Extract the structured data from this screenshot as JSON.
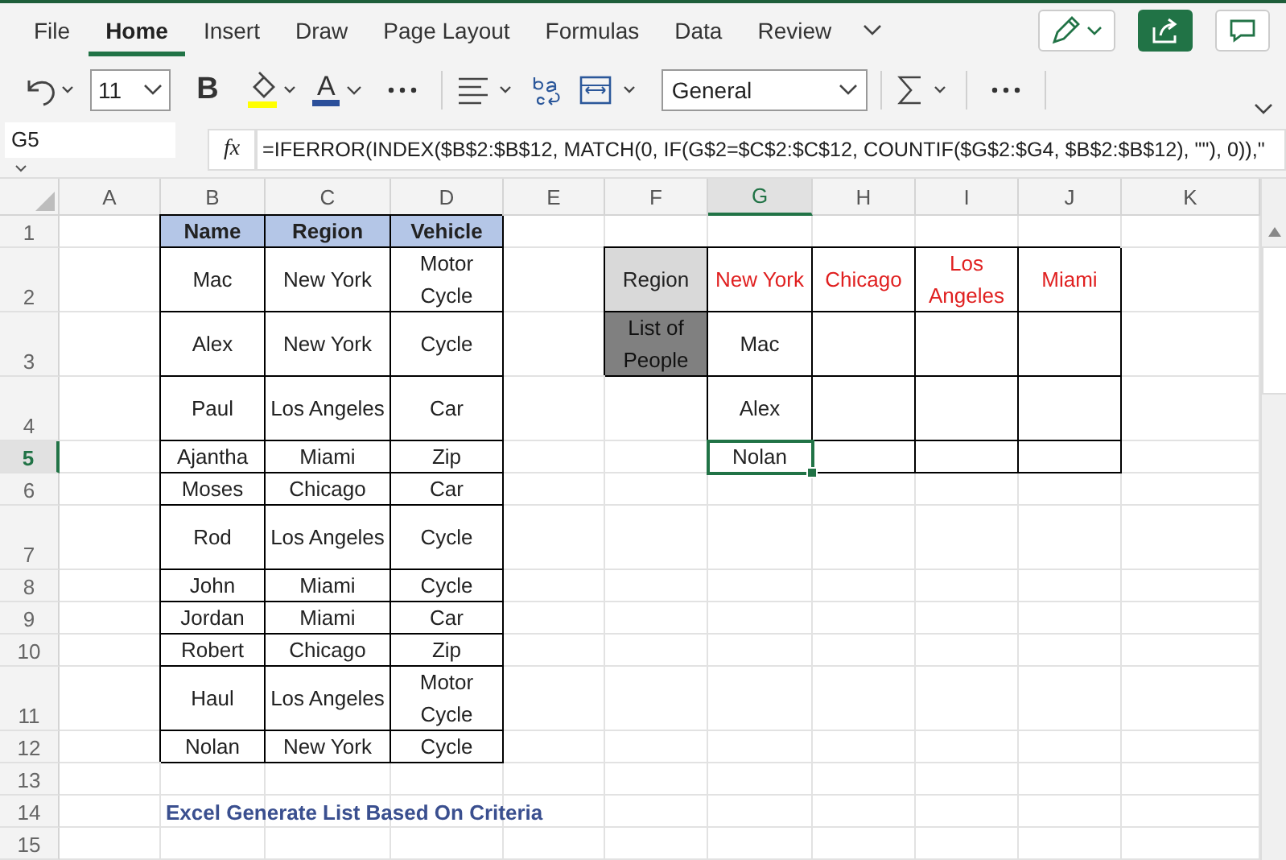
{
  "ribbon": {
    "tabs": [
      {
        "label": "File",
        "selected": false
      },
      {
        "label": "Home",
        "selected": true
      },
      {
        "label": "Insert",
        "selected": false
      },
      {
        "label": "Draw",
        "selected": false
      },
      {
        "label": "Page Layout",
        "selected": false
      },
      {
        "label": "Formulas",
        "selected": false
      },
      {
        "label": "Data",
        "selected": false
      },
      {
        "label": "Review",
        "selected": false
      }
    ]
  },
  "toolbar": {
    "font_size": "11",
    "bold_label": "B",
    "font_color_label": "A",
    "number_format": "General"
  },
  "formula_bar": {
    "name_box": "G5",
    "fx": "fx",
    "formula": "=IFERROR(INDEX($B$2:$B$12, MATCH(0, IF(G$2=$C$2:$C$12, COUNTIF($G$2:$G4, $B$2:$B$12), \"\"), 0)),\""
  },
  "sheet": {
    "columns": [
      {
        "label": "A",
        "selected": false
      },
      {
        "label": "B",
        "selected": false
      },
      {
        "label": "C",
        "selected": false
      },
      {
        "label": "D",
        "selected": false
      },
      {
        "label": "E",
        "selected": false
      },
      {
        "label": "F",
        "selected": false
      },
      {
        "label": "G",
        "selected": true
      },
      {
        "label": "H",
        "selected": false
      },
      {
        "label": "I",
        "selected": false
      },
      {
        "label": "J",
        "selected": false
      },
      {
        "label": "K",
        "selected": false
      }
    ],
    "rows": [
      {
        "label": "1",
        "selected": false
      },
      {
        "label": "2",
        "selected": false
      },
      {
        "label": "3",
        "selected": false
      },
      {
        "label": "4",
        "selected": false
      },
      {
        "label": "5",
        "selected": true
      },
      {
        "label": "6",
        "selected": false
      },
      {
        "label": "7",
        "selected": false
      },
      {
        "label": "8",
        "selected": false
      },
      {
        "label": "9",
        "selected": false
      },
      {
        "label": "10",
        "selected": false
      },
      {
        "label": "11",
        "selected": false
      },
      {
        "label": "12",
        "selected": false
      },
      {
        "label": "13",
        "selected": false
      },
      {
        "label": "14",
        "selected": false
      },
      {
        "label": "15",
        "selected": false
      }
    ]
  },
  "data_table": {
    "headers": [
      "Name",
      "Region",
      "Vehicle"
    ],
    "rows": [
      [
        "Mac",
        "New York",
        "Motor Cycle"
      ],
      [
        "Alex",
        "New York",
        "Cycle"
      ],
      [
        "Paul",
        "Los Angeles",
        "Car"
      ],
      [
        "Ajantha",
        "Miami",
        "Zip"
      ],
      [
        "Moses",
        "Chicago",
        "Car"
      ],
      [
        "Rod",
        "Los Angeles",
        "Cycle"
      ],
      [
        "John",
        "Miami",
        "Cycle"
      ],
      [
        "Jordan",
        "Miami",
        "Car"
      ],
      [
        "Robert",
        "Chicago",
        "Zip"
      ],
      [
        "Haul",
        "Los Angeles",
        "Motor Cycle"
      ],
      [
        "Nolan",
        "New York",
        "Cycle"
      ]
    ]
  },
  "lookup": {
    "region_label": "Region",
    "regions": [
      "New York",
      "Chicago",
      "Los Angeles",
      "Miami"
    ],
    "people_label": "List of People",
    "people": [
      {
        "name": "Mac",
        "selected": false
      },
      {
        "name": "Alex",
        "selected": false
      },
      {
        "name": "Nolan",
        "selected": true
      }
    ]
  },
  "caption": "Excel Generate List Based On Criteria"
}
